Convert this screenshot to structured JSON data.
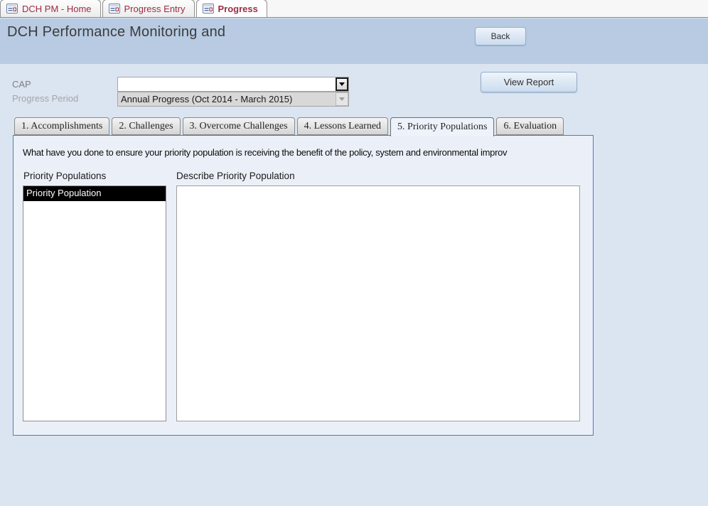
{
  "window_tabs": [
    {
      "label": "DCH PM - Home",
      "active": false
    },
    {
      "label": "Progress Entry",
      "active": false
    },
    {
      "label": "Progress",
      "active": true
    }
  ],
  "header": {
    "title": "DCH Performance Monitoring and",
    "back_label": "Back"
  },
  "filters": {
    "cap_label": "CAP",
    "cap_value": "",
    "progress_period_label": "Progress Period",
    "progress_period_value": "Annual Progress (Oct 2014 - March 2015)",
    "view_report_label": "View Report"
  },
  "form_tabs": [
    {
      "label": "1. Accomplishments",
      "active": false
    },
    {
      "label": "2. Challenges",
      "active": false
    },
    {
      "label": "3. Overcome Challenges",
      "active": false
    },
    {
      "label": "4. Lessons Learned",
      "active": false
    },
    {
      "label": "5. Priority Populations",
      "active": true
    },
    {
      "label": "6. Evaluation",
      "active": false
    }
  ],
  "panel": {
    "question": "What have you done to ensure your priority population is receiving the benefit of the policy, system and environmental improv",
    "list_label": "Priority Populations",
    "describe_label": "Describe Priority Population",
    "list_items": [
      {
        "label": "Priority Population",
        "selected": true
      }
    ],
    "describe_value": ""
  },
  "icons": {
    "form_icon": "access-form-icon",
    "dropdown_enabled": "dropdown-arrow-icon",
    "dropdown_disabled": "dropdown-arrow-disabled-icon"
  },
  "colors": {
    "header_band": "#b8cbe2",
    "page_background": "#dbe5f1",
    "panel_background": "#ebf0f8",
    "panel_border": "#4a7ebb",
    "doc_tab_text": "#9b2d43",
    "button_border": "#93aecc",
    "combo_disabled_bg": "#d8d8d8",
    "list_selection_bg": "#000000",
    "list_selection_text": "#ffffff"
  }
}
